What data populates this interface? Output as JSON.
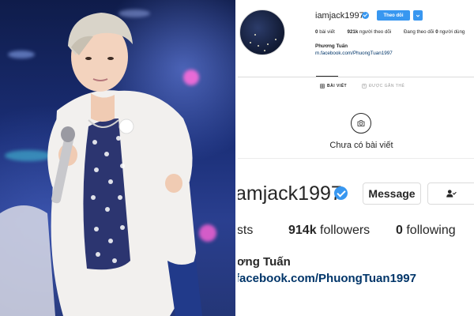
{
  "profile_top": {
    "username": "iamjack1997",
    "follow_label": "Theo dõi",
    "stats": [
      {
        "value": "0",
        "label": "bài viết"
      },
      {
        "value": "921k",
        "label": "người theo dõi"
      },
      {
        "value": "0",
        "label": "người dùng",
        "prefix": "Đang theo dõi"
      }
    ],
    "full_name": "Phương Tuấn",
    "link": "m.facebook.com/PhuongTuan1997",
    "tabs": [
      {
        "label": "BÀI VIẾT",
        "icon": "grid-icon",
        "active": true
      },
      {
        "label": "ĐƯỢC GẮN THẺ",
        "icon": "tag-icon",
        "active": false
      }
    ],
    "empty_text": "Chưa có bài viết"
  },
  "profile_zoom": {
    "username": "amjack1997",
    "message_label": "Message",
    "posts_label": "osts",
    "followers_value": "914k",
    "followers_label": "followers",
    "following_value": "0",
    "following_label": "following",
    "full_name": "ương Tuấn",
    "link": "facebook.com/PhuongTuan1997"
  },
  "colors": {
    "accent": "#3897f0",
    "link": "#003569",
    "text": "#262626",
    "photo_bg": "#1b2f78"
  },
  "icons": [
    "verified-icon",
    "chevron-down-icon",
    "grid-icon",
    "tag-icon",
    "camera-icon",
    "user-check-icon"
  ]
}
